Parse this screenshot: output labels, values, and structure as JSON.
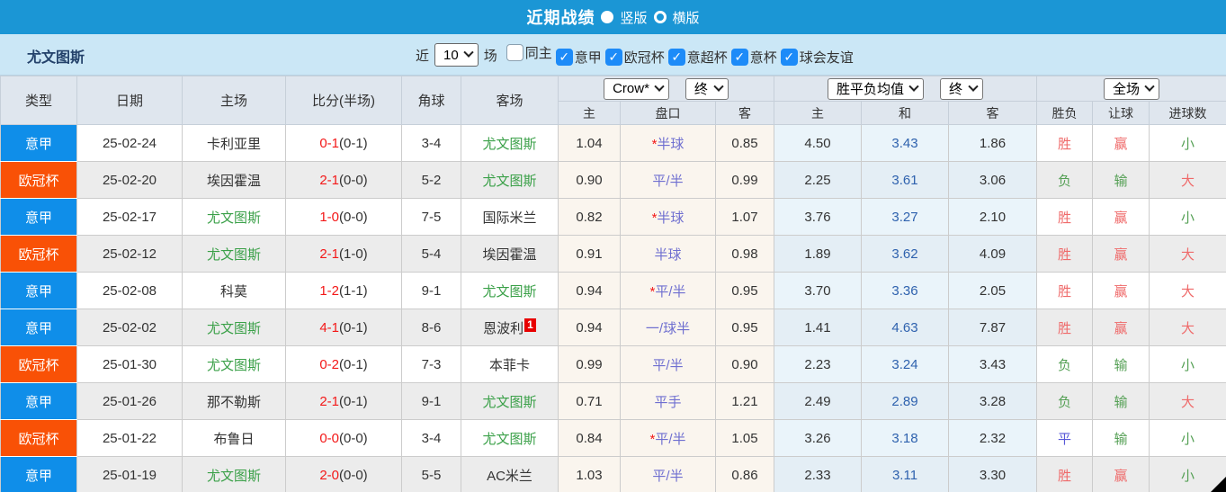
{
  "top_bar": {
    "title": "近期战绩",
    "radio_vertical_label": "竖版",
    "radio_horizontal_label": "横版"
  },
  "filter_bar": {
    "team": "尤文图斯",
    "recent_label": "近",
    "recent_value": "10",
    "matches_label": "场",
    "checkboxes": [
      {
        "label": "同主",
        "checked": false
      },
      {
        "label": "意甲",
        "checked": true
      },
      {
        "label": "欧冠杯",
        "checked": true
      },
      {
        "label": "意超杯",
        "checked": true
      },
      {
        "label": "意杯",
        "checked": true
      },
      {
        "label": "球会友谊",
        "checked": true
      }
    ]
  },
  "table": {
    "columns": {
      "type": "类型",
      "date": "日期",
      "home": "主场",
      "score": "比分(半场)",
      "corner": "角球",
      "away": "客场",
      "sub": [
        "主",
        "盘口",
        "客",
        "主",
        "和",
        "客",
        "胜负",
        "让球",
        "进球数"
      ]
    },
    "selectors": {
      "odds_company": "Crow*",
      "odds_time": "终",
      "avg_label": "胜平负均值",
      "avg_time": "终",
      "scope": "全场"
    },
    "type_colors": {
      "意甲": "#0f8ee9",
      "欧冠杯": "#f95106"
    },
    "value_colors": {
      "胜": "red",
      "负": "green",
      "平": "blue",
      "赢": "red",
      "输": "green",
      "大": "red",
      "小": "green"
    },
    "rows": [
      {
        "type": "意甲",
        "date": "25-02-24",
        "home": "卡利亚里",
        "score": "0-1",
        "half": "(0-1)",
        "corner": "3-4",
        "away": "尤文图斯",
        "away_sup": "",
        "odds_home": "1.04",
        "handicap": "*半球",
        "odds_away": "0.85",
        "avg_home": "4.50",
        "avg_draw": "3.43",
        "avg_away": "1.86",
        "result": "胜",
        "handicap_result": "赢",
        "goals": "小"
      },
      {
        "type": "欧冠杯",
        "date": "25-02-20",
        "home": "埃因霍温",
        "score": "2-1",
        "half": "(0-0)",
        "corner": "5-2",
        "away": "尤文图斯",
        "away_sup": "",
        "odds_home": "0.90",
        "handicap": "平/半",
        "odds_away": "0.99",
        "avg_home": "2.25",
        "avg_draw": "3.61",
        "avg_away": "3.06",
        "result": "负",
        "handicap_result": "输",
        "goals": "大"
      },
      {
        "type": "意甲",
        "date": "25-02-17",
        "home": "尤文图斯",
        "score": "1-0",
        "half": "(0-0)",
        "corner": "7-5",
        "away": "国际米兰",
        "away_sup": "",
        "odds_home": "0.82",
        "handicap": "*半球",
        "odds_away": "1.07",
        "avg_home": "3.76",
        "avg_draw": "3.27",
        "avg_away": "2.10",
        "result": "胜",
        "handicap_result": "赢",
        "goals": "小"
      },
      {
        "type": "欧冠杯",
        "date": "25-02-12",
        "home": "尤文图斯",
        "score": "2-1",
        "half": "(1-0)",
        "corner": "5-4",
        "away": "埃因霍温",
        "away_sup": "",
        "odds_home": "0.91",
        "handicap": "半球",
        "odds_away": "0.98",
        "avg_home": "1.89",
        "avg_draw": "3.62",
        "avg_away": "4.09",
        "result": "胜",
        "handicap_result": "赢",
        "goals": "大"
      },
      {
        "type": "意甲",
        "date": "25-02-08",
        "home": "科莫",
        "score": "1-2",
        "half": "(1-1)",
        "corner": "9-1",
        "away": "尤文图斯",
        "away_sup": "",
        "odds_home": "0.94",
        "handicap": "*平/半",
        "odds_away": "0.95",
        "avg_home": "3.70",
        "avg_draw": "3.36",
        "avg_away": "2.05",
        "result": "胜",
        "handicap_result": "赢",
        "goals": "大"
      },
      {
        "type": "意甲",
        "date": "25-02-02",
        "home": "尤文图斯",
        "score": "4-1",
        "half": "(0-1)",
        "corner": "8-6",
        "away": "恩波利",
        "away_sup": "1",
        "odds_home": "0.94",
        "handicap": "一/球半",
        "odds_away": "0.95",
        "avg_home": "1.41",
        "avg_draw": "4.63",
        "avg_away": "7.87",
        "result": "胜",
        "handicap_result": "赢",
        "goals": "大"
      },
      {
        "type": "欧冠杯",
        "date": "25-01-30",
        "home": "尤文图斯",
        "score": "0-2",
        "half": "(0-1)",
        "corner": "7-3",
        "away": "本菲卡",
        "away_sup": "",
        "odds_home": "0.99",
        "handicap": "平/半",
        "odds_away": "0.90",
        "avg_home": "2.23",
        "avg_draw": "3.24",
        "avg_away": "3.43",
        "result": "负",
        "handicap_result": "输",
        "goals": "小"
      },
      {
        "type": "意甲",
        "date": "25-01-26",
        "home": "那不勒斯",
        "score": "2-1",
        "half": "(0-1)",
        "corner": "9-1",
        "away": "尤文图斯",
        "away_sup": "",
        "odds_home": "0.71",
        "handicap": "平手",
        "odds_away": "1.21",
        "avg_home": "2.49",
        "avg_draw": "2.89",
        "avg_away": "3.28",
        "result": "负",
        "handicap_result": "输",
        "goals": "大"
      },
      {
        "type": "欧冠杯",
        "date": "25-01-22",
        "home": "布鲁日",
        "score": "0-0",
        "half": "(0-0)",
        "corner": "3-4",
        "away": "尤文图斯",
        "away_sup": "",
        "odds_home": "0.84",
        "handicap": "*平/半",
        "odds_away": "1.05",
        "avg_home": "3.26",
        "avg_draw": "3.18",
        "avg_away": "2.32",
        "result": "平",
        "handicap_result": "输",
        "goals": "小"
      },
      {
        "type": "意甲",
        "date": "25-01-19",
        "home": "尤文图斯",
        "score": "2-0",
        "half": "(0-0)",
        "corner": "5-5",
        "away": "AC米兰",
        "away_sup": "",
        "odds_home": "1.03",
        "handicap": "平/半",
        "odds_away": "0.86",
        "avg_home": "2.33",
        "avg_draw": "3.11",
        "avg_away": "3.30",
        "result": "胜",
        "handicap_result": "赢",
        "goals": "小"
      }
    ]
  }
}
